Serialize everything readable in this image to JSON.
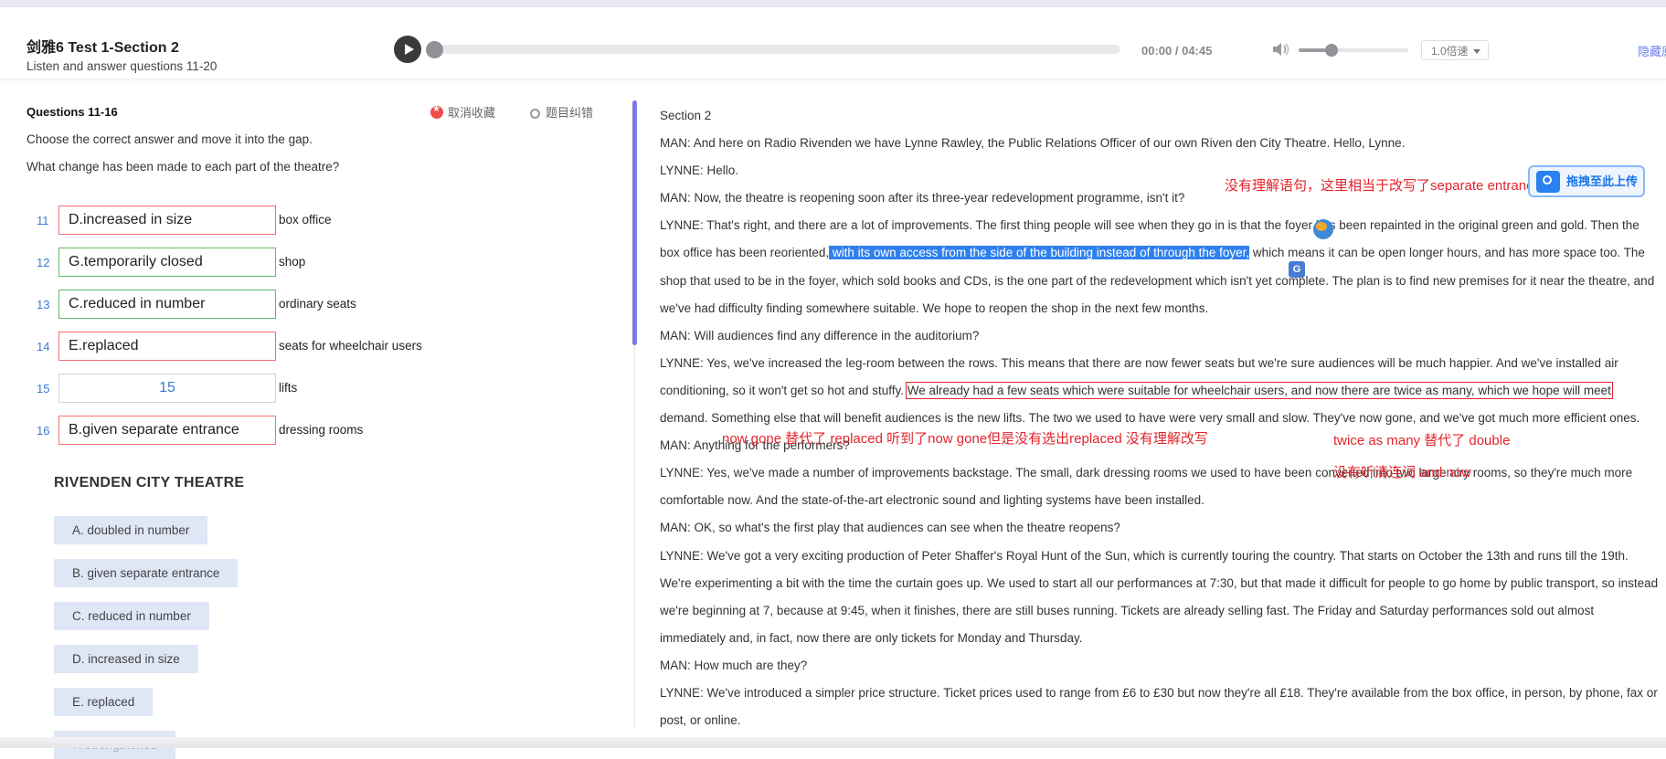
{
  "header": {
    "title": "剑雅6   Test 1-Section 2",
    "subtitle": "Listen and answer questions 11-20",
    "time": "00:00 / 04:45",
    "speed": "1.0倍速",
    "hide_link": "隐藏原"
  },
  "progress": {
    "fraction": 0.0,
    "volume_fraction": 0.3
  },
  "questions": {
    "heading": "Questions 11-16",
    "favorite": "取消收藏",
    "report": "题目纠错",
    "instruction1": "Choose the correct answer and move it into the gap.",
    "instruction2": "What change has been made to each part of the theatre?",
    "items": [
      {
        "num": "11",
        "answer": "D.increased in size",
        "label": "box office"
      },
      {
        "num": "12",
        "answer": "G.temporarily closed",
        "label": "shop"
      },
      {
        "num": "13",
        "answer": "C.reduced in number",
        "label": "ordinary seats"
      },
      {
        "num": "14",
        "answer": "E.replaced",
        "label": "seats for wheelchair users"
      },
      {
        "num": "15",
        "answer": "15",
        "label": "lifts"
      },
      {
        "num": "16",
        "answer": "B.given separate entrance",
        "label": "dressing rooms"
      }
    ]
  },
  "options": {
    "heading": "RIVENDEN CITY THEATRE",
    "items": [
      "A. doubled in number",
      "B. given separate entrance",
      "C. reduced in number",
      "D. increased in size",
      "E. replaced",
      "F. strengthened"
    ]
  },
  "transcript": {
    "section": "Section 2",
    "l1": "MAN: And here on Radio Rivenden we have Lynne Rawley, the Public Relations Officer of our own Riven den City Theatre. Hello, Lynne.",
    "l2": "LYNNE: Hello.",
    "l3": "MAN: Now, the theatre is reopening soon after its three-year redevelopment programme, isn't it?",
    "l4a": "LYNNE: That's right, and there are a lot of improvements. The first thing people will see when they go in is that the foyer has been repainted in the original green and gold. Then the box office has been reoriented,",
    "l4hl": " with its own access from the side of the building instead of through the foyer,",
    "l4b": " which means it can be open longer hours, and has more space too. The shop that used to be in the foyer, which sold books and CDs, is the one part of the redevelopment which isn't yet complete. The plan is to find new premises for it near the theatre, and we've had difficulty finding somewhere suitable. We hope to reopen the shop in the next few months.",
    "l5": "MAN: Will audiences find any difference in the auditorium?",
    "l6a": "LYNNE: Yes, we've increased the leg-room between the rows. This means that there are now fewer seats but we're sure audiences will be much happier. And we've installed air conditioning, so it won't get so hot and stuffy.",
    "l6box": "We already had a few seats which were suitable for wheelchair users, and now there are twice as many, which we hope will meet",
    "l6b": " demand. Something else that will benefit audiences is the new lifts. The two we used to have were very small and slow. They've now gone, and we've got much more efficient ones.",
    "l7": "MAN: Anything for the performers?",
    "l8": "LYNNE: Yes, we've made a number of improvements backstage. The small, dark dressing rooms we used to have been converted into two large airy rooms, so they're much more comfortable now. And the state-of-the-art electronic sound and lighting systems have been installed.",
    "l9": "MAN: OK, so what's the first play that audiences can see when the theatre reopens?",
    "l10": "LYNNE: We've got a very exciting production of Peter Shaffer's Royal Hunt of the Sun, which is currently touring the country. That starts on October the 13th and runs till the 19th. We're experimenting a bit with the time the curtain goes up. We used to start all our performances at 7:30, but that made it difficult for people to go home by public transport, so instead we're beginning at 7, because at 9:45, when it finishes, there are still buses running. Tickets are already selling fast. The Friday and Saturday performances sold out almost immediately and, in fact, now there are only tickets for Monday and Thursday.",
    "l11": "MAN: How much are they?",
    "l12": "LYNNE: We've introduced a simpler price structure. Ticket prices used to range from £6 to £30 but now they're all £18. They're available from the box office, in person, by phone, fax or post, or online."
  },
  "annotations": {
    "a1": "没有理解语句，这里相当于改写了separate entrance",
    "a2": "now gone 替代了 replaced   听到了now gone但是没有选出replaced 没有理解改写",
    "a3": "twice as many 替代了 double",
    "a4": "没有听清连词 and now"
  },
  "upload_label": "拖拽至此上传",
  "colors": {
    "accent": "#2f80ed",
    "annotation": "#e3242b",
    "wrong_border": "#f07070",
    "correct_border": "#5cbd63",
    "divider": "#7c7cde"
  }
}
